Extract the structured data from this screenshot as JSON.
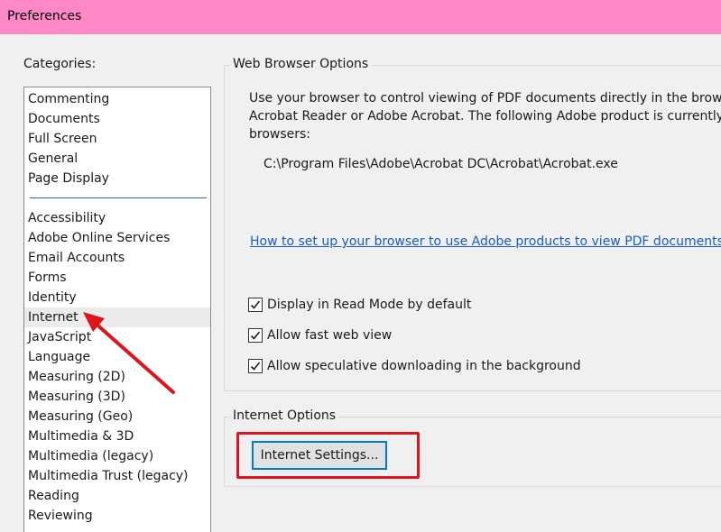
{
  "window": {
    "title": "Preferences"
  },
  "colors": {
    "titlebar": "#ff88c8",
    "annotation": "#e0141e",
    "link": "#1a5ec2"
  },
  "categories": {
    "label": "Categories:",
    "selected": "Internet",
    "group1": [
      "Commenting",
      "Documents",
      "Full Screen",
      "General",
      "Page Display"
    ],
    "group2": [
      "Accessibility",
      "Adobe Online Services",
      "Email Accounts",
      "Forms",
      "Identity",
      "Internet",
      "JavaScript",
      "Language",
      "Measuring (2D)",
      "Measuring (3D)",
      "Measuring (Geo)",
      "Multimedia & 3D",
      "Multimedia (legacy)",
      "Multimedia Trust (legacy)",
      "Reading",
      "Reviewing"
    ]
  },
  "web_browser_options": {
    "legend": "Web Browser Options",
    "description_line1": "Use your browser to control viewing of PDF documents directly in the browser u",
    "description_line2": "Acrobat Reader or Adobe Acrobat. The following Adobe product is currently av",
    "description_line3": "browsers:",
    "product_path": "C:\\Program Files\\Adobe\\Acrobat DC\\Acrobat\\Acrobat.exe",
    "help_link": "How to set up your browser to use Adobe products to view PDF documents",
    "checkboxes": [
      {
        "label": "Display in Read Mode by default",
        "checked": true
      },
      {
        "label": "Allow fast web view",
        "checked": true
      },
      {
        "label": "Allow speculative downloading in the background",
        "checked": true
      }
    ]
  },
  "internet_options": {
    "legend": "Internet Options",
    "settings_button": "Internet Settings..."
  },
  "annotations": {
    "arrow_target": "Internet",
    "highlight_target": "Internet Settings..."
  }
}
